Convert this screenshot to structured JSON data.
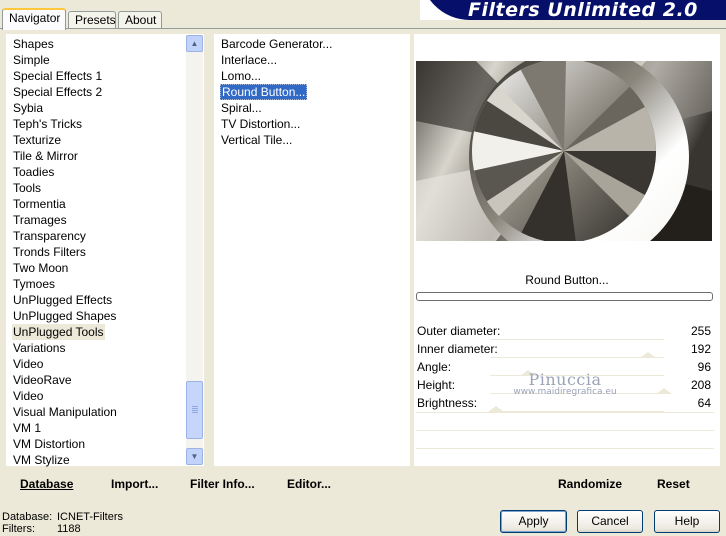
{
  "app": {
    "title": "Filters Unlimited 2.0"
  },
  "tabs": [
    {
      "label": "Navigator",
      "active": true
    },
    {
      "label": "Presets",
      "active": false
    },
    {
      "label": "About",
      "active": false
    }
  ],
  "categories": [
    "Shapes",
    "Simple",
    "Special Effects 1",
    "Special Effects 2",
    "Sybia",
    "Teph's Tricks",
    "Texturize",
    "Tile & Mirror",
    "Toadies",
    "Tools",
    "Tormentia",
    "Tramages",
    "Transparency",
    "Tronds Filters",
    "Two Moon",
    "Tymoes",
    "UnPlugged Effects",
    "UnPlugged Shapes",
    "UnPlugged Tools",
    "Variations",
    "Video",
    "VideoRave",
    "Video",
    "Visual Manipulation",
    "VM 1",
    "VM Distortion",
    "VM Stylize"
  ],
  "selected_category": "UnPlugged Tools",
  "filters": [
    "Barcode Generator...",
    "Interlace...",
    "Lomo...",
    "Round Button...",
    "Spiral...",
    "TV Distortion...",
    "Vertical Tile..."
  ],
  "selected_filter": "Round Button...",
  "preview": {
    "caption": "Round Button..."
  },
  "params": [
    {
      "label": "Outer diameter:",
      "value": "255"
    },
    {
      "label": "Inner diameter:",
      "value": "192"
    },
    {
      "label": "Angle:",
      "value": "96"
    },
    {
      "label": "Height:",
      "value": "208"
    },
    {
      "label": "Brightness:",
      "value": "64"
    }
  ],
  "watermark": {
    "name": "Pinuccia",
    "url": "www.maidiregrafica.eu"
  },
  "toolbar": {
    "database_label": "Database",
    "import_label": "Import...",
    "filter_info_label": "Filter Info...",
    "editor_label": "Editor...",
    "randomize_label": "Randomize",
    "reset_label": "Reset"
  },
  "status": {
    "database_key": "Database:",
    "database_value": "ICNET-Filters",
    "filters_key": "Filters:",
    "filters_value": "1188"
  },
  "buttons": {
    "apply_label": "Apply",
    "cancel_label": "Cancel",
    "help_label": "Help"
  },
  "colors": {
    "window_bg": "#ece9d8",
    "banner_bg": "#06106a",
    "selection_blue": "#316ac5"
  }
}
